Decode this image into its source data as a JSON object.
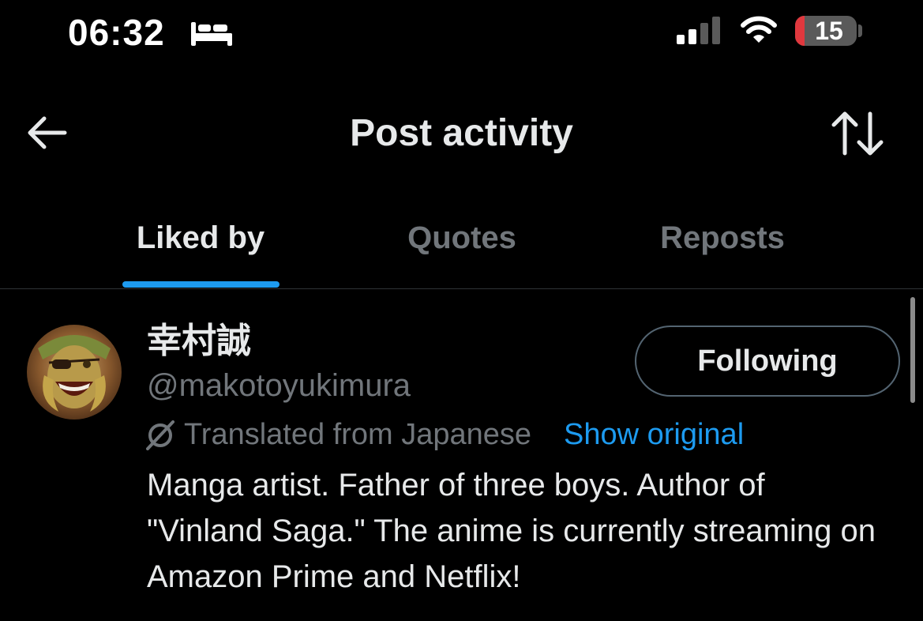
{
  "status_bar": {
    "time": "06:32",
    "battery_level": "15",
    "battery_fraction": 0.15,
    "focus_icon": "bed-icon",
    "signal_bars_active": 2,
    "signal_bars_total": 4
  },
  "header": {
    "title": "Post activity",
    "back_icon": "back-arrow-icon",
    "sort_icon": "sort-icon"
  },
  "tabs": [
    {
      "label": "Liked by",
      "active": true
    },
    {
      "label": "Quotes",
      "active": false
    },
    {
      "label": "Reposts",
      "active": false
    }
  ],
  "user": {
    "display_name": "幸村誠",
    "handle": "@makotoyukimura",
    "follow_label": "Following",
    "translated_label": "Translated from Japanese",
    "show_original_label": "Show original",
    "bio": "Manga artist. Father of three boys. Author of \"Vinland Saga.\" The anime is currently streaming on Amazon Prime and Netflix!"
  },
  "colors": {
    "background": "#000000",
    "accent": "#1d9bf0",
    "muted_text": "#71767b",
    "battery_low": "#e0383e"
  }
}
